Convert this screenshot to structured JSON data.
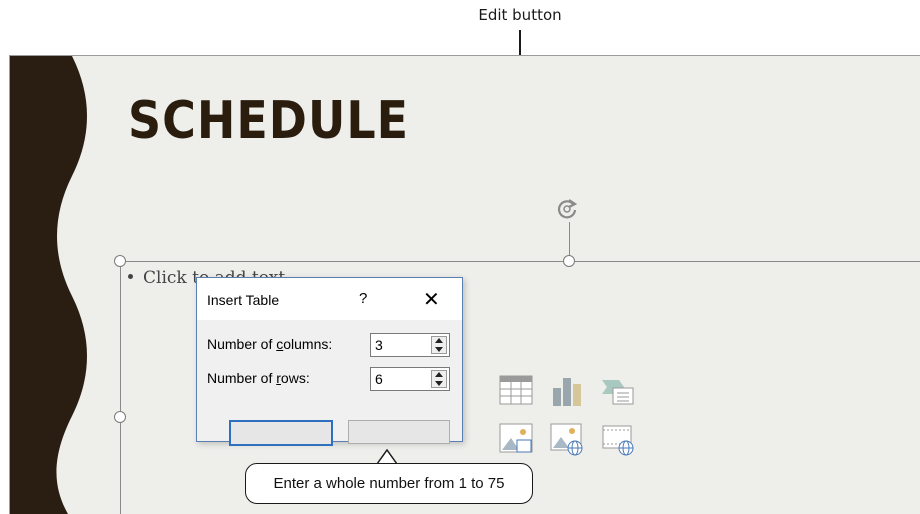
{
  "callout": {
    "label": "Edit button"
  },
  "slide": {
    "title": "SCHEDULE",
    "placeholder_text": "Click to add text",
    "colors": {
      "background": "#eeeeeb",
      "title": "#2b1d0e",
      "wave": "#2a1e12"
    }
  },
  "content_icons": [
    "table-icon",
    "chart-icon",
    "smartart-icon",
    "picture-icon",
    "online-picture-icon",
    "video-icon"
  ],
  "dialog": {
    "title": "Insert Table",
    "help": "?",
    "close": "✕",
    "columns_label_pre": "Number of ",
    "columns_label_accel": "c",
    "columns_label_post": "olumns:",
    "columns_value": "3",
    "rows_label_pre": "Number of ",
    "rows_label_accel": "r",
    "rows_label_post": "ows:",
    "rows_value": "6"
  },
  "tooltip": {
    "text": "Enter a whole number from 1 to 75"
  }
}
